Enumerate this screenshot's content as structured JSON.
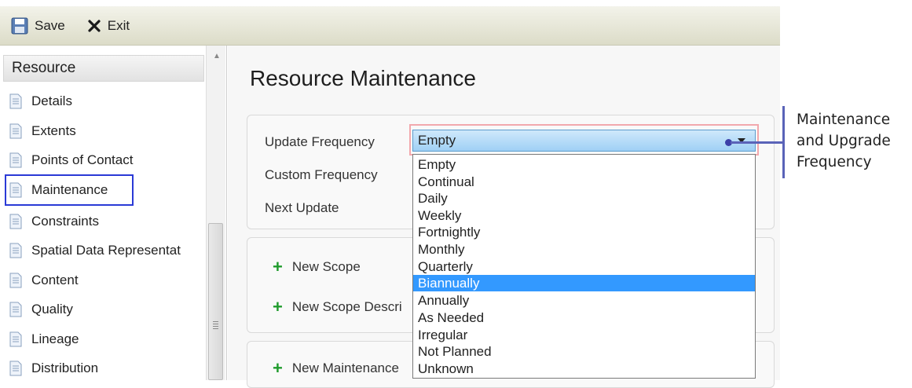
{
  "toolbar": {
    "save_label": "Save",
    "exit_label": "Exit"
  },
  "sidebar": {
    "header": "Resource",
    "items": [
      {
        "label": "Details"
      },
      {
        "label": "Extents"
      },
      {
        "label": "Points of Contact"
      },
      {
        "label": "Maintenance"
      },
      {
        "label": "Constraints"
      },
      {
        "label": "Spatial Data Representat"
      },
      {
        "label": "Content"
      },
      {
        "label": "Quality"
      },
      {
        "label": "Lineage"
      },
      {
        "label": "Distribution"
      }
    ]
  },
  "main": {
    "title": "Resource Maintenance",
    "fields": {
      "update_frequency": "Update Frequency",
      "custom_frequency": "Custom Frequency",
      "next_update": "Next Update"
    },
    "links": {
      "new_scope": "New Scope",
      "new_scope_description": "New Scope Descri",
      "new_maintenance": "New Maintenance"
    }
  },
  "dropdown": {
    "selected_value": "Empty",
    "highlighted": "Biannually",
    "options": [
      "Empty",
      "Continual",
      "Daily",
      "Weekly",
      "Fortnightly",
      "Monthly",
      "Quarterly",
      "Biannually",
      "Annually",
      "As Needed",
      "Irregular",
      "Not Planned",
      "Unknown"
    ]
  },
  "callout": {
    "lines": [
      "Maintenance",
      "and Upgrade",
      "Frequency"
    ]
  },
  "colors": {
    "highlight": "#3399ff",
    "outline_blue": "#2a3ad6",
    "add_green": "#1f9b2c",
    "callout": "#5a63b8"
  }
}
